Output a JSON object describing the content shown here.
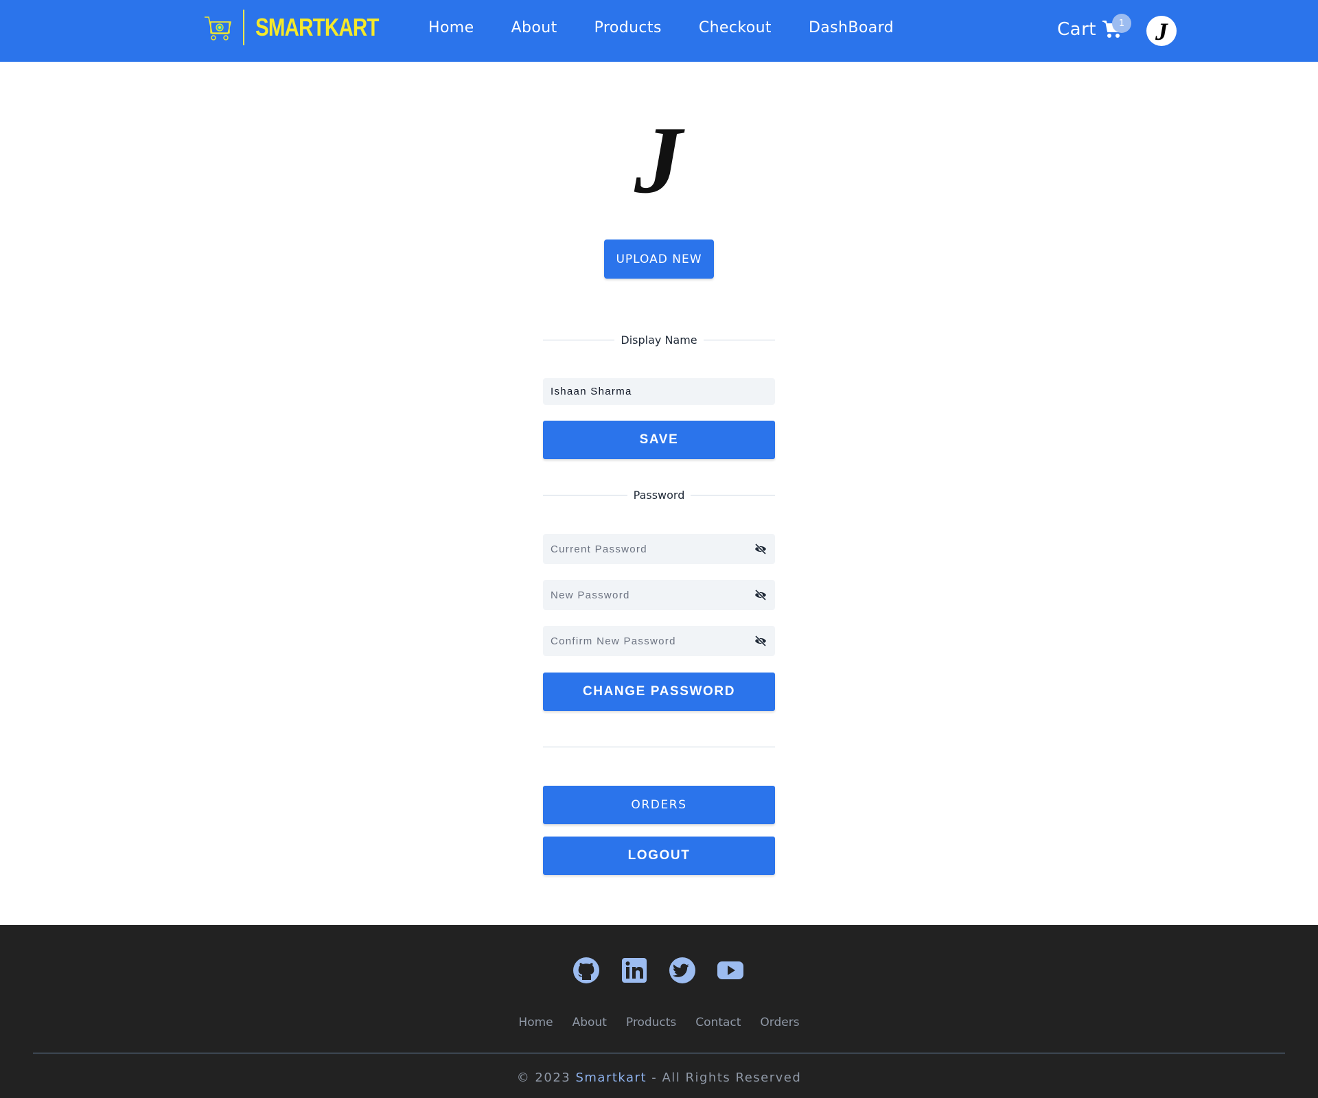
{
  "navbar": {
    "brand": "SMARTKART",
    "links": [
      "Home",
      "About",
      "Products",
      "Checkout",
      "DashBoard"
    ],
    "cart_label": "Cart",
    "cart_count": "1",
    "avatar_letter": "J"
  },
  "profile": {
    "picture_letter": "J",
    "upload_label": "UPLOAD NEW"
  },
  "display_name": {
    "section_label": "Display Name",
    "value": "Ishaan Sharma",
    "save_label": "SAVE"
  },
  "password": {
    "section_label": "Password",
    "current_placeholder": "Current Password",
    "new_placeholder": "New Password",
    "confirm_placeholder": "Confirm New Password",
    "change_label": "CHANGE PASSWORD"
  },
  "account": {
    "orders_label": "ORDERS",
    "logout_label": "LOGOUT"
  },
  "footer": {
    "social": [
      "github-icon",
      "linkedin-icon",
      "twitter-icon",
      "youtube-icon"
    ],
    "links": [
      "Home",
      "About",
      "Products",
      "Contact",
      "Orders"
    ],
    "copyright_prefix": "© 2023 ",
    "copyright_brand": "Smartkart",
    "copyright_suffix": " - All Rights Reserved"
  },
  "colors": {
    "primary": "#2b74eb",
    "brand_yellow": "#f5e92a",
    "footer_bg": "#222222",
    "field_bg": "#f1f4f7"
  }
}
